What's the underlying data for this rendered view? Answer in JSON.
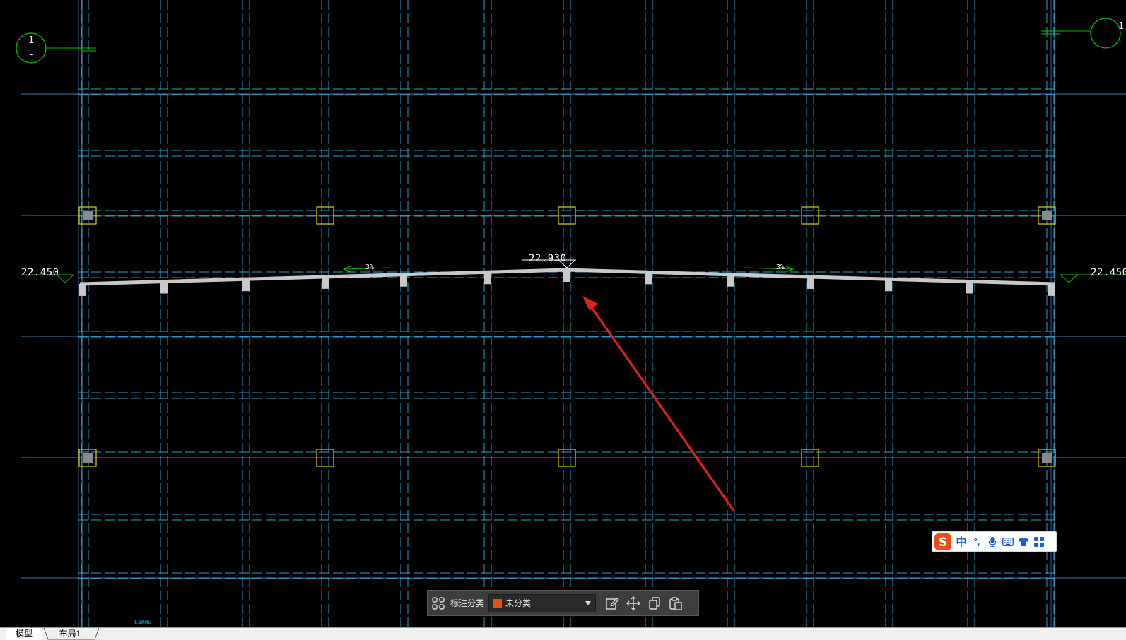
{
  "drawing": {
    "axis_left": {
      "number": "1",
      "sub": "-"
    },
    "axis_right": {
      "number": "1",
      "sub": "-"
    },
    "level_left": "22.450",
    "level_right": "22.450",
    "level_center": "22.930",
    "slope_left": "3%",
    "slope_right": "3%",
    "small_label": "Ea@mu",
    "colors": {
      "background": "#000000",
      "grid_solid": "#3a7fb0",
      "grid_dashed": "#2aa0c8",
      "axis_bubble": "#00c000",
      "column_box": "#d8d800",
      "roof_profile": "#c8c8c8",
      "arrow": "#e8201c"
    }
  },
  "annotation_toolbar": {
    "label": "标注分类",
    "category": "未分类",
    "category_color": "#e85010",
    "icons": [
      "grid-apps-icon",
      "edit-icon",
      "move-icon",
      "copy-icon",
      "paste-icon"
    ]
  },
  "ime_bar": {
    "logo": "S",
    "lang": "中",
    "punct": "°,",
    "icons": [
      "sogou-logo-icon",
      "microphone-icon",
      "keyboard-icon",
      "shirt-icon",
      "apps-icon"
    ]
  },
  "tabs": [
    {
      "label": "模型",
      "active": true
    },
    {
      "label": "布局1",
      "active": false
    }
  ]
}
